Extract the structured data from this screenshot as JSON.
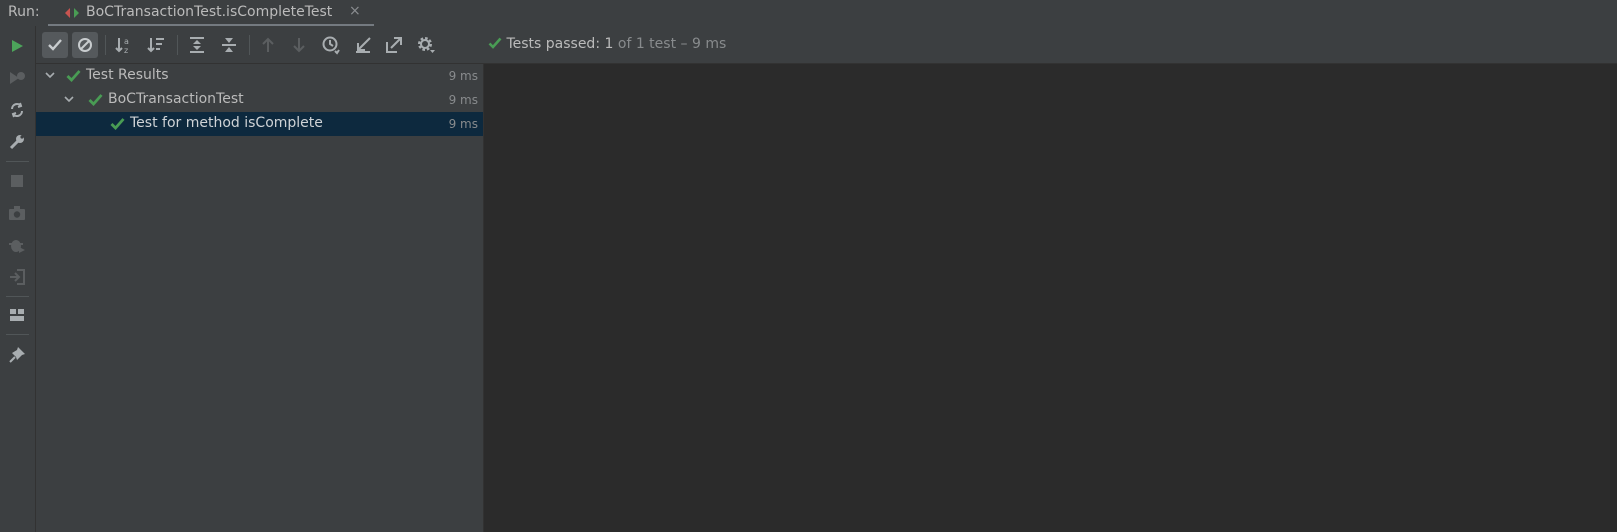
{
  "tabbar": {
    "run_label": "Run:",
    "tab_title": "BoCTransactionTest.isCompleteTest",
    "close_glyph": "×"
  },
  "left_toolbar": {
    "icons": [
      "rerun-icon",
      "rerun-failed-icon",
      "toggle-auto-test-icon",
      "settings-wrench-icon",
      "stop-icon",
      "dump-threads-icon",
      "debug-icon",
      "exit-icon",
      "layout-icon",
      "pin-icon"
    ]
  },
  "toolbar": {
    "icons": [
      "show-passed-icon",
      "show-ignored-icon",
      "sort-alphabetically-icon",
      "sort-by-duration-icon",
      "expand-all-icon",
      "collapse-all-icon",
      "previous-failed-icon",
      "next-failed-icon",
      "test-history-icon",
      "import-tests-icon",
      "export-tests-icon",
      "gear-icon"
    ],
    "status": {
      "prefix": "Tests passed: ",
      "count": "1",
      "suffix": " of 1 test – 9 ms"
    }
  },
  "tree": {
    "rows": [
      {
        "label": "Test Results",
        "time": "9 ms"
      },
      {
        "label": "BoCTransactionTest",
        "time": "9 ms"
      },
      {
        "label": "Test for method isComplete",
        "time": "9 ms"
      }
    ]
  },
  "colors": {
    "pass_green": "#499c54",
    "run_green": "#4ca45a",
    "selection": "#0d293e",
    "panel": "#3c3f41",
    "console_bg": "#2b2b2b"
  }
}
